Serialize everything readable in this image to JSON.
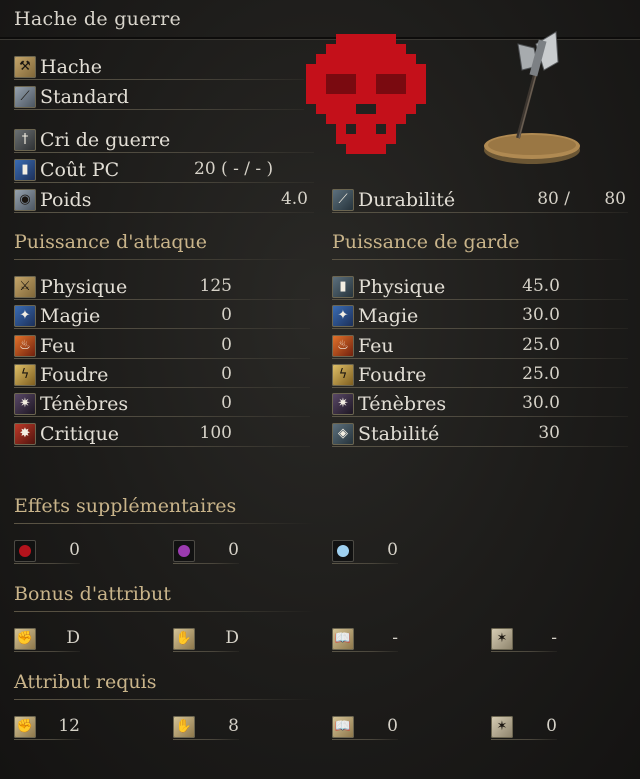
{
  "title": "Hache de guerre",
  "colors": {
    "skull": "#c4101a",
    "section": "#c9b48a"
  },
  "info": [
    {
      "icon": "axe-type-icon",
      "label": "Hache"
    },
    {
      "icon": "attack-type-icon",
      "label": "Standard"
    },
    {
      "icon": "skill-icon",
      "label": "Cri de guerre"
    },
    {
      "icon": "fp-cost-icon",
      "label": "Coût PC",
      "value": "20 (    -  /     -  )"
    },
    {
      "icon": "weight-icon",
      "label": "Poids",
      "value": "4.0"
    }
  ],
  "durability": {
    "icon": "durability-icon",
    "label": "Durabilité",
    "current": "80 /",
    "max": "80"
  },
  "attack": {
    "heading": "Puissance d'attaque",
    "rows": [
      {
        "icon": "physical-attack-icon",
        "label": "Physique",
        "value": "125"
      },
      {
        "icon": "magic-attack-icon",
        "label": "Magie",
        "value": "0"
      },
      {
        "icon": "fire-attack-icon",
        "label": "Feu",
        "value": "0"
      },
      {
        "icon": "lightning-attack-icon",
        "label": "Foudre",
        "value": "0"
      },
      {
        "icon": "dark-attack-icon",
        "label": "Ténèbres",
        "value": "0"
      },
      {
        "icon": "critical-icon",
        "label": "Critique",
        "value": "100"
      }
    ]
  },
  "guard": {
    "heading": "Puissance de garde",
    "rows": [
      {
        "icon": "physical-guard-icon",
        "label": "Physique",
        "value": "45.0"
      },
      {
        "icon": "magic-guard-icon",
        "label": "Magie",
        "value": "30.0"
      },
      {
        "icon": "fire-guard-icon",
        "label": "Feu",
        "value": "25.0"
      },
      {
        "icon": "lightning-guard-icon",
        "label": "Foudre",
        "value": "25.0"
      },
      {
        "icon": "dark-guard-icon",
        "label": "Ténèbres",
        "value": "30.0"
      },
      {
        "icon": "stability-icon",
        "label": "Stabilité",
        "value": "30"
      }
    ]
  },
  "effects": {
    "heading": "Effets supplémentaires",
    "items": [
      {
        "icon": "bleed-icon",
        "value": "0",
        "color": "#b3131c"
      },
      {
        "icon": "poison-icon",
        "value": "0",
        "color": "#9b3bb0"
      },
      {
        "icon": "frost-icon",
        "value": "0",
        "color": "#9fd0f0"
      }
    ]
  },
  "bonus": {
    "heading": "Bonus d'attribut",
    "items": [
      {
        "icon": "strength-icon",
        "value": "D"
      },
      {
        "icon": "dexterity-icon",
        "value": "D"
      },
      {
        "icon": "intelligence-icon",
        "value": "-"
      },
      {
        "icon": "faith-icon",
        "value": "-"
      }
    ]
  },
  "requirements": {
    "heading": "Attribut requis",
    "items": [
      {
        "icon": "strength-icon",
        "value": "12"
      },
      {
        "icon": "dexterity-icon",
        "value": "8"
      },
      {
        "icon": "intelligence-icon",
        "value": "0"
      },
      {
        "icon": "faith-icon",
        "value": "0"
      }
    ]
  }
}
